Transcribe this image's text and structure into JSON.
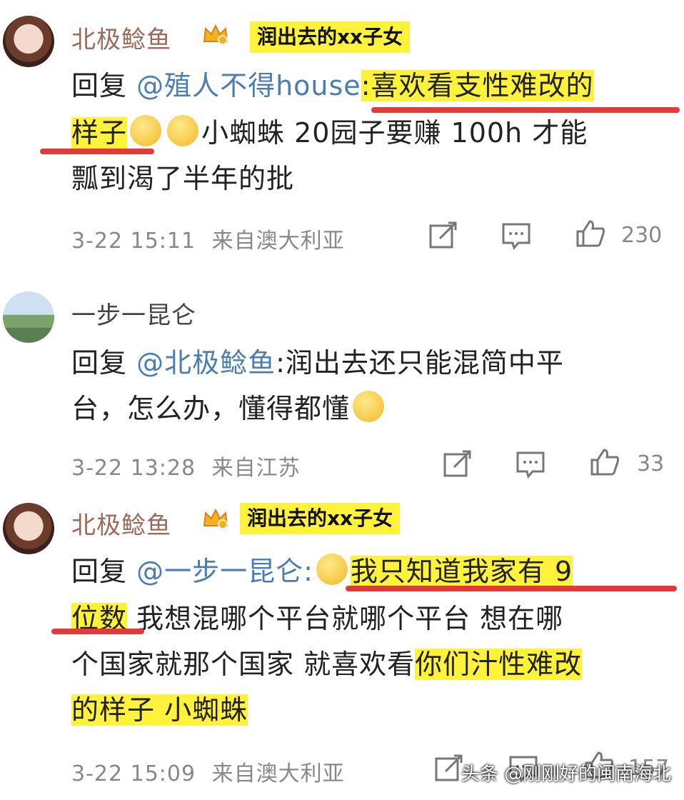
{
  "comments": [
    {
      "username": "北极鲶鱼",
      "tag": "润出去的xx子女",
      "reply_prefix": "回复 ",
      "mention": "@殖人不得house",
      "segments": [
        ":喜欢看支性难改的",
        "样子",
        "小蜘蛛 20园子要赚 100h 才能",
        "瓢到渴了半年的批"
      ],
      "time": "3-22 15:11",
      "location": "来自澳大利亚",
      "likes": "230"
    },
    {
      "username": "一步一昆仑",
      "reply_prefix": "回复 ",
      "mention": "@北极鲶鱼",
      "segments": [
        ":润出去还只能混简中平",
        "台，怎么办，懂得都懂"
      ],
      "time": "3-22 13:28",
      "location": "来自江苏",
      "likes": "33"
    },
    {
      "username": "北极鲶鱼",
      "tag": "润出去的xx子女",
      "reply_prefix": "回复 ",
      "mention": "@一步一昆仑:",
      "segments": [
        "我只知道我家有 9",
        "位数",
        " 我想混哪个平台就哪个平台 想在哪",
        "个国家就那个国家 就喜欢看",
        "你们汁性难改",
        "的样子 小蜘蛛"
      ],
      "time": "3-22 15:09",
      "location": "来自澳大利亚",
      "likes": "157"
    }
  ],
  "watermark": "头条 @刚刚好的闽南海北"
}
